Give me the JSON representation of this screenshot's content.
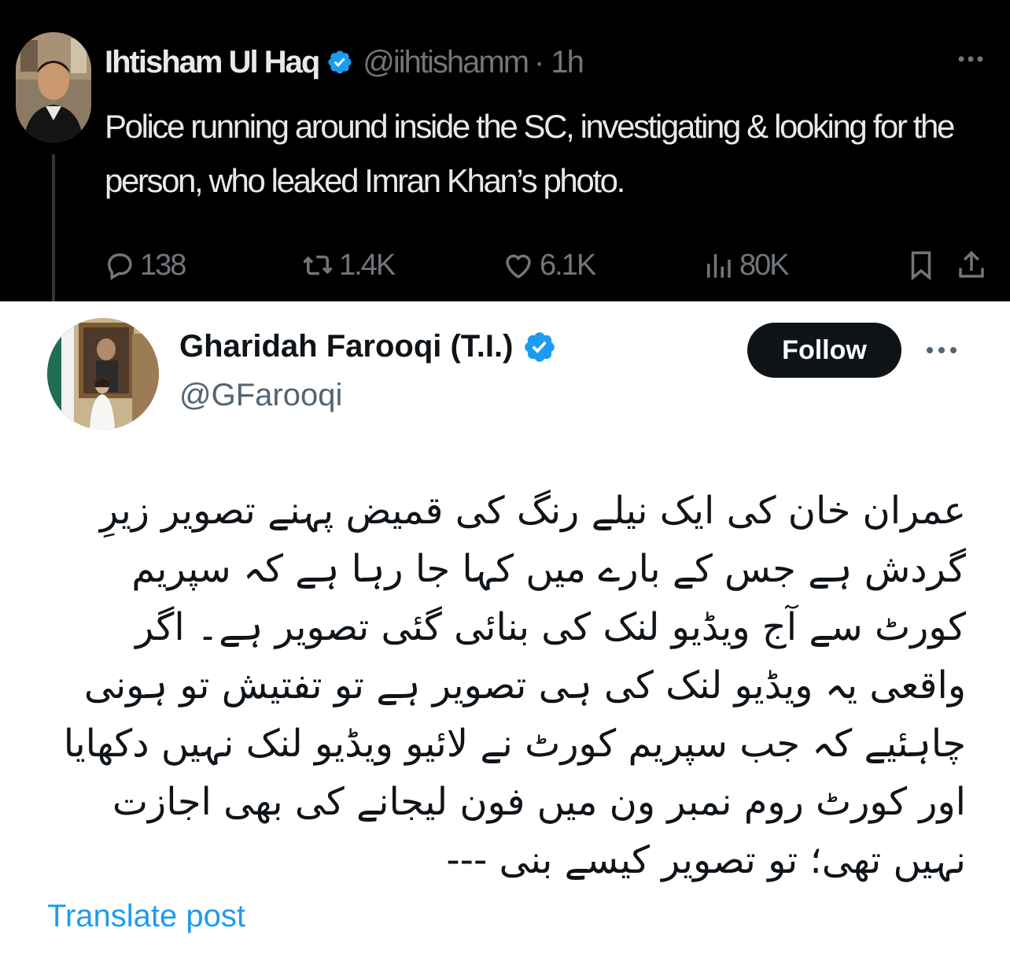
{
  "colors": {
    "dark_background": "#000000",
    "dark_text": "#e7e9ea",
    "dark_muted": "#71767b",
    "light_text": "#0f1419",
    "light_muted": "#536471",
    "verified_blue": "#1d9bf0",
    "link_blue": "#1d9bf0",
    "follow_button_bg": "#0f1419"
  },
  "top_tweet": {
    "author_name": "Ihtisham Ul Haq",
    "handle": "@iihtishamm",
    "separator": "·",
    "time": "1h",
    "verified": true,
    "text": "Police running around inside the SC,  investigating & looking for the person, who leaked Imran Khan’s photo.",
    "actions": {
      "replies": "138",
      "reposts": "1.4K",
      "likes": "6.1K",
      "views": "80K"
    },
    "icons": [
      "verified-badge-icon",
      "more-icon",
      "reply-icon",
      "retweet-icon",
      "like-icon",
      "views-icon",
      "bookmark-icon",
      "share-icon"
    ]
  },
  "main_tweet": {
    "author_name": "Gharidah Farooqi (T.I.)",
    "handle": "@GFarooqi",
    "verified": true,
    "follow_label": "Follow",
    "text": "عمران خان کی ایک نیلے رنگ کی قمیض پہنے تصویر زیرِ گردش ہے جس کے بارے میں کہا جا رہا ہے کہ سپریم کورٹ سے آج ویڈیو لنک کی بنائی گئی تصویر ہے۔ اگر واقعی یہ ویڈیو لنک کی ہی تصویر ہے تو تفتیش تو ہونی چاہئیے کہ جب سپریم کورٹ نے لائیو ویڈیو لنک نہیں دکھایا اور کورٹ روم نمبر ون میں فون لیجانے کی بھی اجازت نہیں تھی؛ تو تصویر کیسے بنی ---",
    "translate_label": "Translate post",
    "icons": [
      "verified-badge-icon",
      "more-icon"
    ]
  }
}
